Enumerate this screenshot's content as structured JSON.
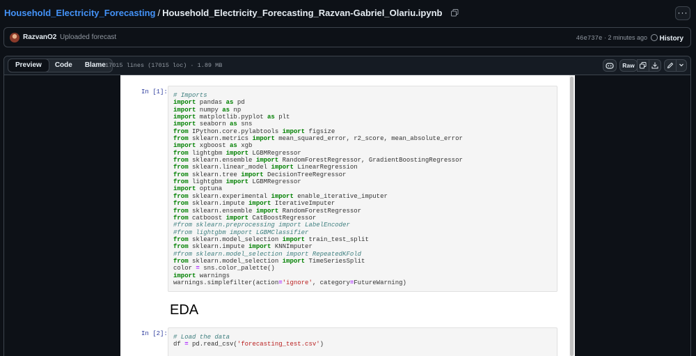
{
  "breadcrumb": {
    "repo": "Household_Electricity_Forecasting",
    "separator": "/",
    "file": "Household_Electricity_Forecasting_Razvan-Gabriel_Olariu.ipynb"
  },
  "more_button": "···",
  "commit": {
    "author": "RazvanO2",
    "message": "Uploaded forecast",
    "sha": "46e737e",
    "time": " · 2 minutes ago",
    "history_label": "History"
  },
  "file_header": {
    "tabs": [
      "Preview",
      "Code",
      "Blame"
    ],
    "active_tab": "Preview",
    "info": "17015 lines (17015 loc) · 1.89 MB",
    "raw_label": "Raw"
  },
  "notebook": {
    "cell1_prompt": "In [1]:",
    "md_heading": "EDA",
    "cell2_prompt": "In [2]:"
  },
  "icons": [
    "copy-icon",
    "kebab-icon",
    "history-icon",
    "copilot-icon",
    "copy-raw-icon",
    "download-icon",
    "pencil-icon",
    "chevron-down-icon"
  ]
}
